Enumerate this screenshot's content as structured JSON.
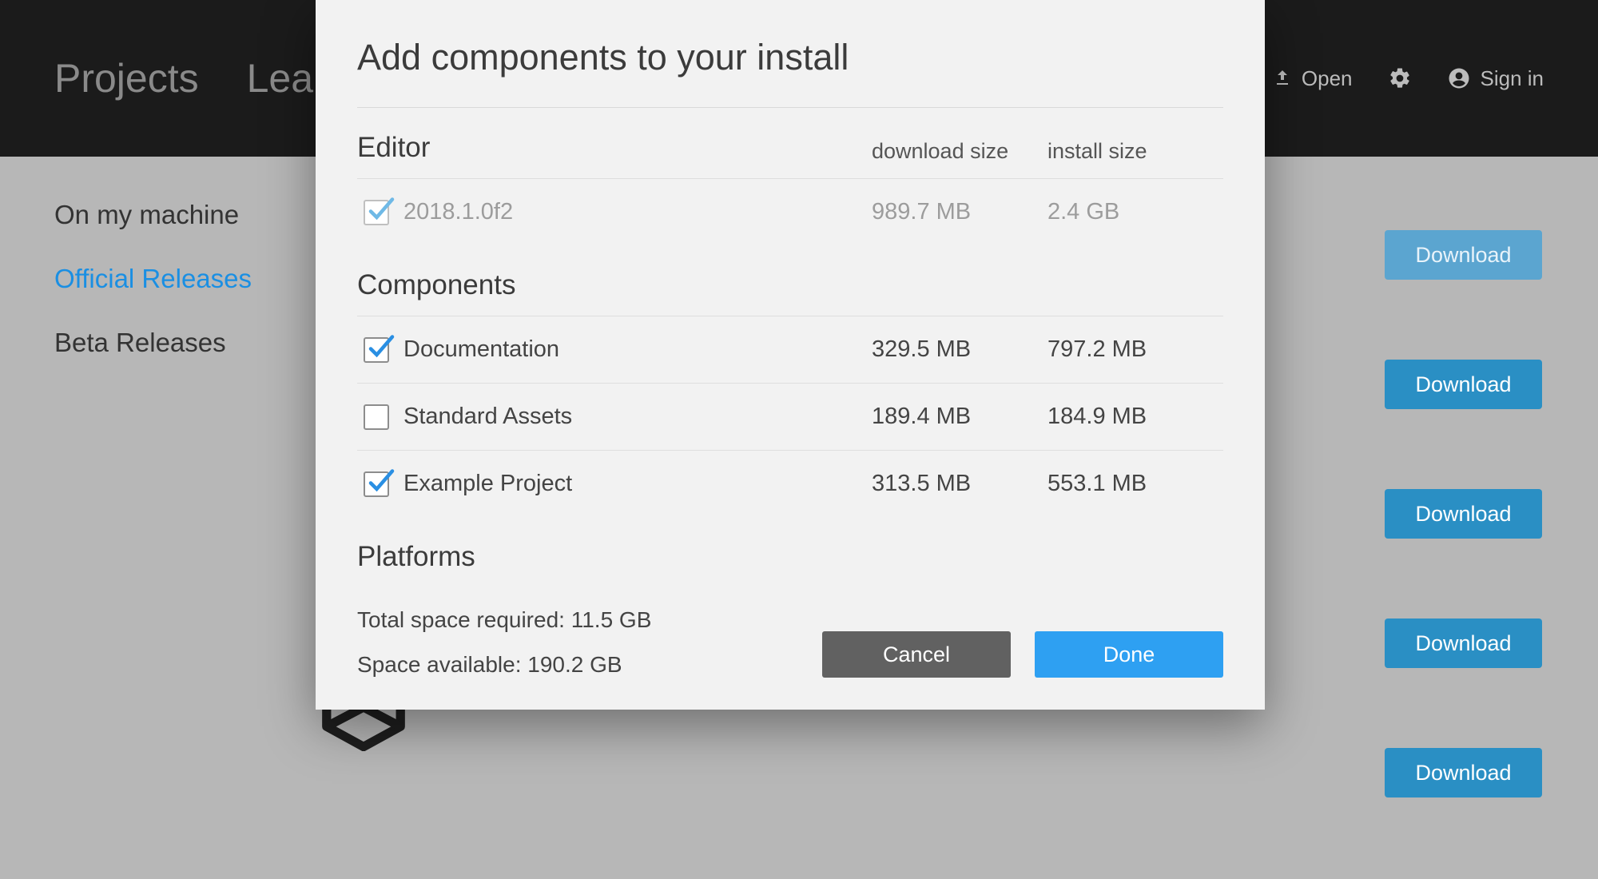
{
  "topbar": {
    "tab_projects": "Projects",
    "tab_learn_frag": "Lea",
    "open_label": "Open",
    "signin_label": "Sign in"
  },
  "sidebar": {
    "items": [
      {
        "label": "On my machine"
      },
      {
        "label": "Official Releases"
      },
      {
        "label": "Beta Releases"
      }
    ]
  },
  "download_button_label": "Download",
  "modal": {
    "title": "Add components to your install",
    "col_download_size": "download size",
    "col_install_size": "install size",
    "section_editor": "Editor",
    "editor_row": {
      "name": "2018.1.0f2",
      "dl": "989.7 MB",
      "in": "2.4 GB",
      "checked": true,
      "disabled": true
    },
    "section_components": "Components",
    "components": [
      {
        "name": "Documentation",
        "dl": "329.5 MB",
        "in": "797.2 MB",
        "checked": true
      },
      {
        "name": "Standard Assets",
        "dl": "189.4 MB",
        "in": "184.9 MB",
        "checked": false
      },
      {
        "name": "Example Project",
        "dl": "313.5 MB",
        "in": "553.1 MB",
        "checked": true
      }
    ],
    "section_platforms": "Platforms",
    "total_space_label": "Total space required:",
    "total_space_value": "11.5 GB",
    "space_avail_label": "Space available:",
    "space_avail_value": "190.2 GB",
    "cancel_label": "Cancel",
    "done_label": "Done"
  }
}
